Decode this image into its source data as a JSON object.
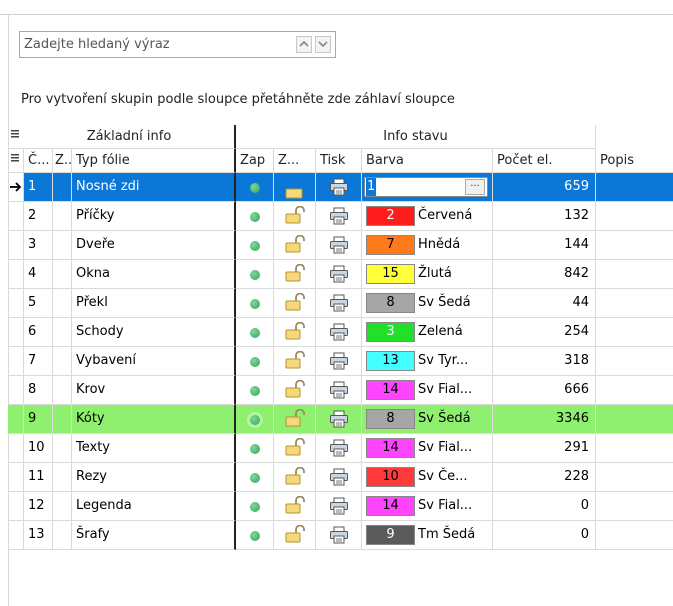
{
  "search": {
    "placeholder": "Zadejte hledaný výraz"
  },
  "group_hint": "Pro vytvoření skupin podle sloupce přetáhněte zde záhlaví sloupce",
  "bands": {
    "basic": "Základní info",
    "status": "Info stavu"
  },
  "columns": {
    "num": "Č...",
    "z": "Z..",
    "type": "Typ fólie",
    "zap": "Zap",
    "lock": "Z...",
    "print": "Tisk",
    "color": "Barva",
    "count": "Počet el.",
    "desc": "Popis"
  },
  "rows": [
    {
      "num": "1",
      "type": "Nosné zdi",
      "color_num": "1",
      "color_name": "",
      "swatch": "#ffffff",
      "swatch_text": "#000000",
      "count": "659",
      "state": "selected"
    },
    {
      "num": "2",
      "type": "Příčky",
      "color_num": "2",
      "color_name": "Červená",
      "swatch": "#ff1c1c",
      "swatch_text": "#ffffff",
      "count": "132",
      "state": ""
    },
    {
      "num": "3",
      "type": "Dveře",
      "color_num": "7",
      "color_name": "Hnědá",
      "swatch": "#ff7a1a",
      "swatch_text": "#000000",
      "count": "144",
      "state": ""
    },
    {
      "num": "4",
      "type": "Okna",
      "color_num": "15",
      "color_name": "Žlutá",
      "swatch": "#ffff3a",
      "swatch_text": "#000000",
      "count": "842",
      "state": ""
    },
    {
      "num": "5",
      "type": "Překl",
      "color_num": "8",
      "color_name": "Sv Šedá",
      "swatch": "#a6a6a6",
      "swatch_text": "#000000",
      "count": "44",
      "state": ""
    },
    {
      "num": "6",
      "type": "Schody",
      "color_num": "3",
      "color_name": "Zelená",
      "swatch": "#22e02a",
      "swatch_text": "#ffffff",
      "count": "254",
      "state": ""
    },
    {
      "num": "7",
      "type": "Vybavení",
      "color_num": "13",
      "color_name": "Sv Tyr...",
      "swatch": "#44ffff",
      "swatch_text": "#000000",
      "count": "318",
      "state": ""
    },
    {
      "num": "8",
      "type": "Krov",
      "color_num": "14",
      "color_name": "Sv Fial...",
      "swatch": "#ff44ff",
      "swatch_text": "#000000",
      "count": "666",
      "state": ""
    },
    {
      "num": "9",
      "type": "Kóty",
      "color_num": "8",
      "color_name": "Sv Šedá",
      "swatch": "#a6a6a6",
      "swatch_text": "#000000",
      "count": "3346",
      "state": "highlight"
    },
    {
      "num": "10",
      "type": "Texty",
      "color_num": "14",
      "color_name": "Sv Fial...",
      "swatch": "#ff44ff",
      "swatch_text": "#000000",
      "count": "291",
      "state": ""
    },
    {
      "num": "11",
      "type": "Rezy",
      "color_num": "10",
      "color_name": "Sv Če...",
      "swatch": "#ff3a3a",
      "swatch_text": "#000000",
      "count": "228",
      "state": ""
    },
    {
      "num": "12",
      "type": "Legenda",
      "color_num": "14",
      "color_name": "Sv Fial...",
      "swatch": "#ff44ff",
      "swatch_text": "#000000",
      "count": "0",
      "state": ""
    },
    {
      "num": "13",
      "type": "Šrafy",
      "color_num": "9",
      "color_name": "Tm Šedá",
      "swatch": "#5a5a5a",
      "swatch_text": "#ffffff",
      "count": "0",
      "state": ""
    }
  ],
  "colors": {
    "selected_row": "#0b78d7",
    "highlight_row": "#8ef06e",
    "status_dot": "#3cb364"
  }
}
